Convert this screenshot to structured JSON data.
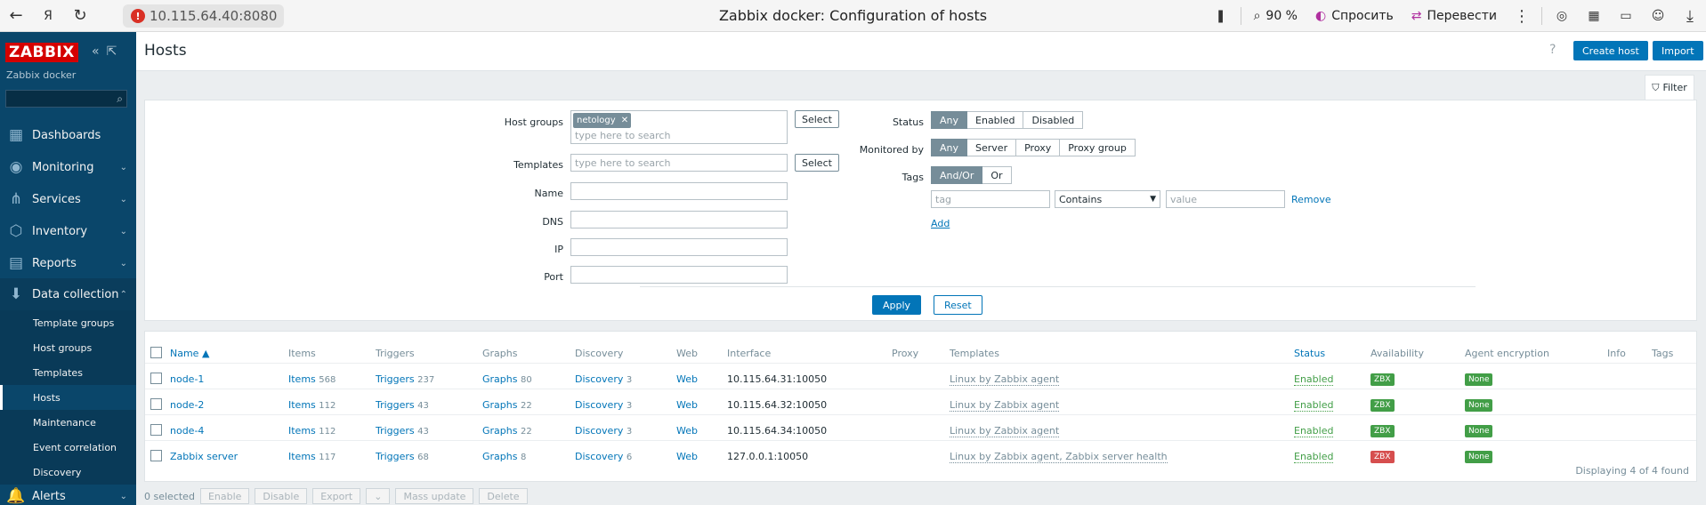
{
  "browser": {
    "url": "10.115.64.40:8080",
    "tab_title": "Zabbix docker: Configuration of hosts",
    "zoom": "90 %",
    "ask": "Спросить",
    "translate": "Перевести"
  },
  "sidebar": {
    "logo": "ZABBIX",
    "server_name": "Zabbix docker",
    "menu": [
      {
        "label": "Dashboards"
      },
      {
        "label": "Monitoring"
      },
      {
        "label": "Services"
      },
      {
        "label": "Inventory"
      },
      {
        "label": "Reports"
      },
      {
        "label": "Data collection"
      }
    ],
    "submenu": [
      {
        "label": "Template groups"
      },
      {
        "label": "Host groups"
      },
      {
        "label": "Templates"
      },
      {
        "label": "Hosts"
      },
      {
        "label": "Maintenance"
      },
      {
        "label": "Event correlation"
      },
      {
        "label": "Discovery"
      }
    ],
    "alerts": "Alerts"
  },
  "header": {
    "title": "Hosts",
    "create_host": "Create host",
    "import": "Import",
    "help": "?"
  },
  "filter": {
    "tab_label": "Filter",
    "host_groups_label": "Host groups",
    "host_group_chip": "netology",
    "placeholder_search": "type here to search",
    "select": "Select",
    "templates_label": "Templates",
    "name_label": "Name",
    "dns_label": "DNS",
    "ip_label": "IP",
    "port_label": "Port",
    "status_label": "Status",
    "status_options": [
      "Any",
      "Enabled",
      "Disabled"
    ],
    "monitored_label": "Monitored by",
    "monitored_options": [
      "Any",
      "Server",
      "Proxy",
      "Proxy group"
    ],
    "tags_label": "Tags",
    "tags_options": [
      "And/Or",
      "Or"
    ],
    "tag_placeholder": "tag",
    "tag_operator": "Contains",
    "value_placeholder": "value",
    "remove": "Remove",
    "add": "Add",
    "apply": "Apply",
    "reset": "Reset"
  },
  "table": {
    "headers": {
      "name": "Name ▲",
      "items": "Items",
      "triggers": "Triggers",
      "graphs": "Graphs",
      "discovery": "Discovery",
      "web": "Web",
      "interface": "Interface",
      "proxy": "Proxy",
      "templates": "Templates",
      "status": "Status",
      "availability": "Availability",
      "encryption": "Agent encryption",
      "info": "Info",
      "tags": "Tags"
    },
    "rows": [
      {
        "name": "node-1",
        "items_label": "Items",
        "items": "568",
        "triggers_label": "Triggers",
        "triggers": "237",
        "graphs_label": "Graphs",
        "graphs": "80",
        "discovery_label": "Discovery",
        "discovery": "3",
        "web": "Web",
        "interface": "10.115.64.31:10050",
        "templates": "Linux by Zabbix agent",
        "status": "Enabled",
        "availability": "ZBX",
        "encryption": "None"
      },
      {
        "name": "node-2",
        "items_label": "Items",
        "items": "112",
        "triggers_label": "Triggers",
        "triggers": "43",
        "graphs_label": "Graphs",
        "graphs": "22",
        "discovery_label": "Discovery",
        "discovery": "3",
        "web": "Web",
        "interface": "10.115.64.32:10050",
        "templates": "Linux by Zabbix agent",
        "status": "Enabled",
        "availability": "ZBX",
        "encryption": "None"
      },
      {
        "name": "node-4",
        "items_label": "Items",
        "items": "112",
        "triggers_label": "Triggers",
        "triggers": "43",
        "graphs_label": "Graphs",
        "graphs": "22",
        "discovery_label": "Discovery",
        "discovery": "3",
        "web": "Web",
        "interface": "10.115.64.34:10050",
        "templates": "Linux by Zabbix agent",
        "status": "Enabled",
        "availability": "ZBX",
        "encryption": "None"
      },
      {
        "name": "Zabbix server",
        "items_label": "Items",
        "items": "117",
        "triggers_label": "Triggers",
        "triggers": "68",
        "graphs_label": "Graphs",
        "graphs": "8",
        "discovery_label": "Discovery",
        "discovery": "6",
        "web": "Web",
        "interface": "127.0.0.1:10050",
        "templates": "Linux by Zabbix agent, Zabbix server health",
        "status": "Enabled",
        "availability": "ZBX",
        "encryption": "None"
      }
    ],
    "footer": "Displaying 4 of 4 found"
  },
  "bottom_bar": {
    "selected": "0 selected",
    "buttons": [
      "Enable",
      "Disable",
      "Export",
      "Mass update",
      "Delete"
    ]
  },
  "colors": {
    "sidebar": "#0a466a",
    "accent": "#0275b8",
    "enabled": "#429e47",
    "zbx_red": "#d64e4e"
  }
}
